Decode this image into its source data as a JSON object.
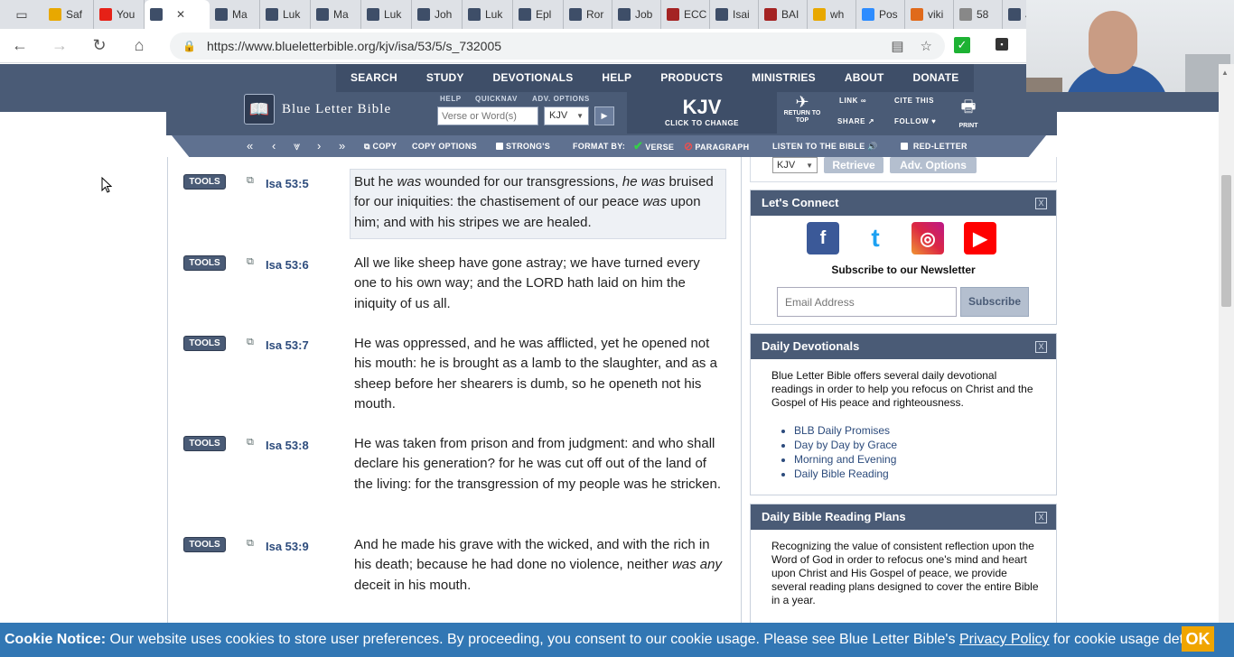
{
  "browser": {
    "tabs": [
      {
        "label": "Saf",
        "color": "#e8a800"
      },
      {
        "label": "You",
        "color": "#e62117"
      },
      {
        "label": "",
        "color": "#3e4e68",
        "active": true
      },
      {
        "label": "Ma",
        "color": "#3e4e68"
      },
      {
        "label": "Luk",
        "color": "#3e4e68"
      },
      {
        "label": "Ma",
        "color": "#3e4e68"
      },
      {
        "label": "Luk",
        "color": "#3e4e68"
      },
      {
        "label": "Joh",
        "color": "#3e4e68"
      },
      {
        "label": "Luk",
        "color": "#3e4e68"
      },
      {
        "label": "Epl",
        "color": "#3e4e68"
      },
      {
        "label": "Ror",
        "color": "#3e4e68"
      },
      {
        "label": "Job",
        "color": "#3e4e68"
      },
      {
        "label": "ECC",
        "color": "#a42323"
      },
      {
        "label": "Isai",
        "color": "#3e4e68"
      },
      {
        "label": "BAI",
        "color": "#a42323"
      },
      {
        "label": "wh",
        "color": "#e8a800"
      },
      {
        "label": "Pos",
        "color": "#2d8cff"
      },
      {
        "label": "viki",
        "color": "#e06a1b"
      },
      {
        "label": "58",
        "color": "#888888"
      },
      {
        "label": "J",
        "color": "#3e4e68"
      }
    ],
    "close_glyph": "✕",
    "url": "https://www.blueletterbible.org/kjv/isa/53/5/s_732005"
  },
  "site_nav": {
    "items": [
      "SEARCH",
      "STUDY",
      "DEVOTIONALS",
      "HELP",
      "PRODUCTS",
      "MINISTRIES",
      "ABOUT",
      "DONATE"
    ]
  },
  "header": {
    "logo_text": "Blue Letter Bible",
    "help_label": "HELP",
    "quicknav_label": "QUICKNAV",
    "adv_options_label": "ADV. OPTIONS",
    "search_placeholder": "Verse or Word(s)",
    "version_value": "KJV",
    "version_big": "KJV",
    "version_small": "CLICK TO CHANGE",
    "return_top": "RETURN TO TOP",
    "link_label": "LINK",
    "share_label": "SHARE",
    "cite_label": "CITE THIS",
    "follow_label": "FOLLOW",
    "print_label": "PRINT"
  },
  "tools_bar": {
    "copy": "COPY",
    "copy_options": "COPY OPTIONS",
    "strongs": "STRONG'S",
    "format_by": "FORMAT BY:",
    "verse": "VERSE",
    "paragraph": "PARAGRAPH",
    "listen": "LISTEN TO THE BIBLE",
    "red_letter": "RED-LETTER"
  },
  "verses": [
    {
      "ref": "Isa 53:5",
      "tools": "TOOLS",
      "text": "But he <i>was</i> wounded for our transgressions, <i>he was</i> bruised for our iniquities: the chastisement of our peace <i>was</i> upon him; and with his stripes we are healed."
    },
    {
      "ref": "Isa 53:6",
      "tools": "TOOLS",
      "text": "All we like sheep have gone astray; we have turned every one to his own way; and the LORD hath laid on him the iniquity of us all."
    },
    {
      "ref": "Isa 53:7",
      "tools": "TOOLS",
      "text": "He was oppressed, and he was afflicted, yet he opened not his mouth: he is brought as a lamb to the slaughter, and as a sheep before her shearers is dumb, so he openeth not his mouth."
    },
    {
      "ref": "Isa 53:8",
      "tools": "TOOLS",
      "text": "He was taken from prison and from judgment: and who shall declare his generation? for he was cut off out of the land of the living: for the transgression of my people was he stricken."
    },
    {
      "ref": "Isa 53:9",
      "tools": "TOOLS",
      "text": "And he made his grave with the wicked, and with the rich in his death; because he had done no violence, neither <i>was any</i> deceit in his mouth."
    }
  ],
  "sidebar": {
    "version": "KJV",
    "retrieve": "Retrieve",
    "adv_options": "Adv. Options",
    "connect": {
      "title": "Let's Connect",
      "close": "X",
      "socials": [
        {
          "name": "facebook",
          "glyph": "f",
          "color": "#3b5998"
        },
        {
          "name": "twitter",
          "glyph": "t",
          "color": "#1da1f2"
        },
        {
          "name": "instagram",
          "glyph": "◎",
          "color": "#d6249f"
        },
        {
          "name": "youtube",
          "glyph": "▶",
          "color": "#ff0000"
        }
      ],
      "newsletter": "Subscribe to our Newsletter",
      "email_placeholder": "Email Address",
      "subscribe": "Subscribe"
    },
    "devotionals": {
      "title": "Daily Devotionals",
      "close": "X",
      "text": "Blue Letter Bible offers several daily devotional readings in order to help you refocus on Christ and the Gospel of His peace and righteousness.",
      "links": [
        "BLB Daily Promises",
        "Day by Day by Grace",
        "Morning and Evening",
        "Daily Bible Reading"
      ]
    },
    "plans": {
      "title": "Daily Bible Reading Plans",
      "close": "X",
      "text": "Recognizing the value of consistent reflection upon the Word of God in order to refocus one's mind and heart upon Christ and His Gospel of peace, we provide several reading plans designed to cover the entire Bible in a year."
    }
  },
  "cookie": {
    "label": "Cookie Notice:",
    "text": " Our website uses cookies to store user preferences. By proceeding, you consent to our cookie usage. Please see Blue Letter Bible's ",
    "link": "Privacy Policy",
    "tail": " for cookie usage details.",
    "ok": "OK"
  },
  "colors": {
    "brand": "#4a5b76",
    "accent": "#3277b4",
    "ok": "#f0a500"
  }
}
